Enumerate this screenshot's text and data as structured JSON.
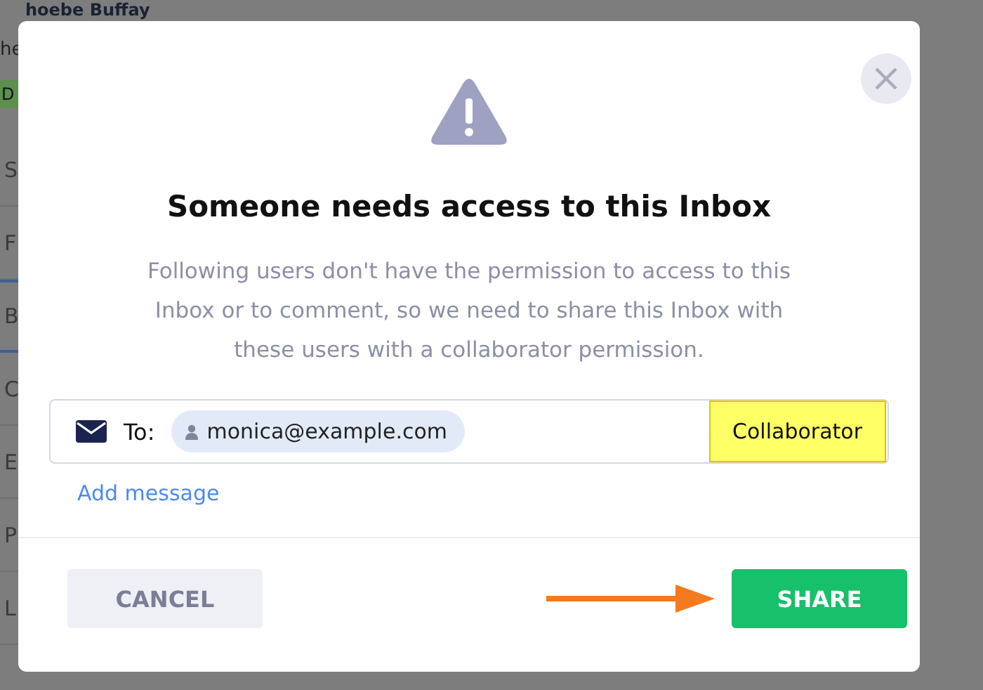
{
  "background": {
    "title": "hoebe Buffay",
    "subtitle": "he",
    "badge": "D",
    "rows": [
      {
        "label": "S",
        "highlighted": false
      },
      {
        "label": "F",
        "highlighted": false
      },
      {
        "label": "B",
        "highlighted": true
      },
      {
        "label": "C",
        "highlighted": false
      },
      {
        "label": "E",
        "highlighted": false
      },
      {
        "label": "P",
        "highlighted": false
      },
      {
        "label": "L",
        "highlighted": false
      }
    ]
  },
  "dialog": {
    "title": "Someone needs access to this Inbox",
    "description": "Following users don't have the permission to access to this Inbox or to comment, so we need to share this Inbox with these users with a collaborator permission.",
    "to_label": "To:",
    "recipients": [
      "monica@example.com"
    ],
    "role": "Collaborator",
    "add_message": "Add message",
    "cancel": "CANCEL",
    "share": "SHARE"
  }
}
